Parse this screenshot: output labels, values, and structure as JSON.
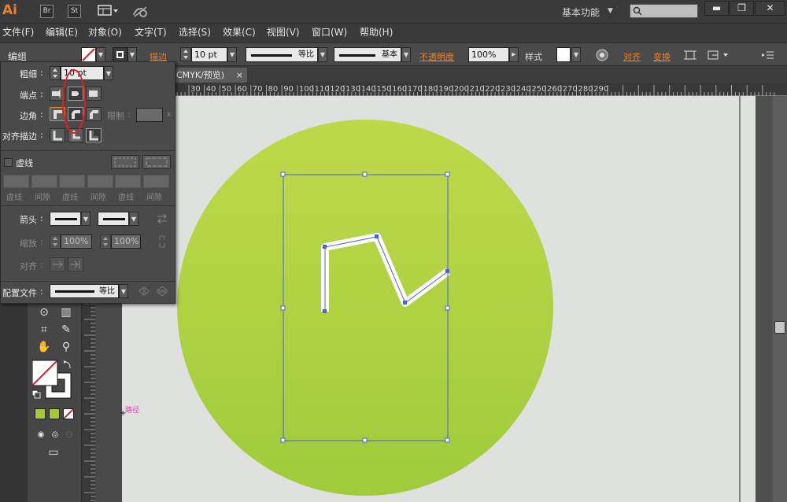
{
  "app": {
    "logo": "Ai",
    "bridge": "Br",
    "stock": "St",
    "workspace": "基本功能",
    "window_min": "▬",
    "window_max": "❐",
    "window_close": "✕"
  },
  "menu": [
    "文件(F)",
    "编组",
    "编辑(E)",
    "对象(O)",
    "文字(T)",
    "选择(S)",
    "效果(C)",
    "视图(V)",
    "窗口(W)",
    "帮助(H)"
  ],
  "menu_items": [
    "文件(F)",
    "编辑(E)",
    "对象(O)",
    "文字(T)",
    "选择(S)",
    "效果(C)",
    "视图(V)",
    "窗口(W)",
    "帮助(H)"
  ],
  "control": {
    "selection": "编组",
    "stroke_label": "描边",
    "stroke_weight": "10 pt",
    "profile_label": "等比",
    "brush_label": "基本",
    "opacity_label": "不透明度",
    "opacity_value": "100%",
    "style_label": "样式",
    "align_label": "对齐",
    "transform_label": "变换"
  },
  "document": {
    "tab": "CMYK/预览)",
    "close": "×"
  },
  "ruler": {
    "ticks": [
      "30",
      "40",
      "50",
      "60",
      "70",
      "80",
      "90",
      "100",
      "110",
      "120",
      "130",
      "140",
      "150",
      "160",
      "170",
      "180",
      "190",
      "200",
      "210",
      "220",
      "230",
      "240",
      "250",
      "260",
      "270",
      "280",
      "290"
    ]
  },
  "stroke_panel": {
    "weight_label": "粗细",
    "weight_value": "10 pt",
    "cap_label": "端点",
    "corner_label": "边角",
    "limit_label": "限制",
    "limit_unit": "x",
    "align_label": "对齐描边",
    "dashed_label": "虚线",
    "dash_labels": [
      "虚线",
      "间隙",
      "虚线",
      "间隙",
      "虚线",
      "间隙"
    ],
    "arrow_label": "箭头",
    "scale_label": "缩放",
    "scale_start": "100%",
    "scale_end": "100%",
    "align_arrow_label": "对齐",
    "profile_label": "配置文件",
    "profile_value": "等比"
  },
  "canvas": {
    "path_label": "路径",
    "circle_color_top": "#bdd94a",
    "circle_color_bottom": "#a0cb3c",
    "stroke_color": "#ffffff",
    "selection_color": "#5060d8"
  },
  "colors": {
    "accent_orange": "#e8812a",
    "highlight_red": "#e02020",
    "fill_green": "#a6c93a"
  }
}
